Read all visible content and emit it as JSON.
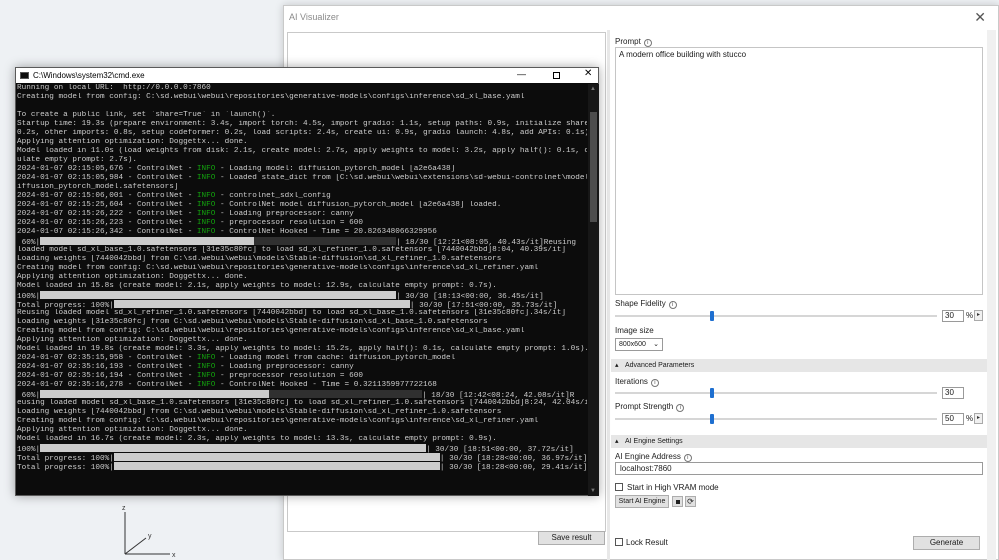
{
  "viz": {
    "title": "AI Visualizer",
    "close": "✕",
    "save_result": "Save result",
    "prompt_label": "Prompt",
    "prompt_text": "A modern office building with stucco",
    "shape_fidelity_label": "Shape Fidelity",
    "shape_fidelity_value": "30",
    "shape_fidelity_level": 0.3,
    "pct": "%",
    "image_size_label": "Image size",
    "image_size_value": "800x600",
    "advanced_header": "Advanced Parameters",
    "iterations_label": "Iterations",
    "iterations_value": "30",
    "iterations_level": 0.3,
    "prompt_strength_label": "Prompt Strength",
    "prompt_strength_value": "50",
    "prompt_strength_level": 0.3,
    "engine_header": "AI Engine Settings",
    "engine_address_label": "AI Engine Address",
    "engine_address_value": "localhost:7860",
    "high_vram_label": "Start in High VRAM mode",
    "start_engine": "Start AI Engine",
    "lock_result": "Lock Result",
    "generate": "Generate",
    "info_glyph": "i",
    "refresh_glyph": "⟳",
    "chevron": "⌄",
    "collapse": "▴",
    "step": "▸"
  },
  "cmd": {
    "title": "C:\\Windows\\system32\\cmd.exe",
    "min": "—",
    "close": "✕",
    "scroll_up": "▲",
    "scroll_down": "▼",
    "lines": [
      {
        "t": "Running on local URL:  http://0.0.0.0:7860"
      },
      {
        "t": "Creating model from config: C:\\sd.webui\\webui\\repositories\\generative-models\\configs\\inference\\sd_xl_base.yaml"
      },
      {
        "t": ""
      },
      {
        "t": "To create a public link, set `share=True` in `launch()`."
      },
      {
        "t": "Startup time: 19.3s (prepare environment: 3.4s, import torch: 4.5s, import gradio: 1.1s, setup paths: 0.9s, initialize shared:"
      },
      {
        "t": "0.2s, other imports: 0.8s, setup codeformer: 0.2s, load scripts: 2.4s, create ui: 0.9s, gradio launch: 4.8s, add APIs: 0.1s)."
      },
      {
        "t": "Applying attention optimization: Doggettx... done."
      },
      {
        "t": "Model loaded in 11.0s (load weights from disk: 2.1s, create model: 2.7s, apply weights to model: 3.2s, apply half(): 0.1s, calc"
      },
      {
        "t": "ulate empty prompt: 2.7s)."
      },
      {
        "a": "2024-01-07 02:15:05,676 - ControlNet - ",
        "g": "INFO",
        "b": " - Loading model: diffusion_pytorch_model [a2e6a438]"
      },
      {
        "a": "2024-01-07 02:15:05,984 - ControlNet - ",
        "g": "INFO",
        "b": " - Loaded state_dict from [C:\\sd.webui\\webui\\extensions\\sd-webui-controlnet\\models\\d"
      },
      {
        "t": "iffusion_pytorch_model.safetensors]"
      },
      {
        "a": "2024-01-07 02:15:06,001 - ControlNet - ",
        "g": "INFO",
        "b": " - controlnet_sdxl_config"
      },
      {
        "a": "2024-01-07 02:15:25,604 - ControlNet - ",
        "g": "INFO",
        "b": " - ControlNet model diffusion_pytorch_model [a2e6a438] loaded."
      },
      {
        "a": "2024-01-07 02:15:26,222 - ControlNet - ",
        "g": "INFO",
        "b": " - Loading preprocessor: canny"
      },
      {
        "a": "2024-01-07 02:15:26,223 - ControlNet - ",
        "g": "INFO",
        "b": " - preprocessor resolution = 600"
      },
      {
        "a": "2024-01-07 02:15:26,342 - ControlNet - ",
        "g": "INFO",
        "b": " - ControlNet Hooked - Time = 20.826348066329956"
      },
      {
        "p": " 60%|",
        "fill": 0.6,
        "w": 356,
        "r": "| 18/30 [12:21<08:05, 40.43s/it]Reusing"
      },
      {
        "t": "loaded model sd_xl_base_1.0.safetensors [31e35c80fc] to load sd_xl_refiner_1.0.safetensors [7440042bbd]8:04, 40.39s/it]"
      },
      {
        "t": "Loading weights [7440042bbd] from C:\\sd.webui\\webui\\models\\Stable-diffusion\\sd_xl_refiner_1.0.safetensors"
      },
      {
        "t": "Creating model from config: C:\\sd.webui\\webui\\repositories\\generative-models\\configs\\inference\\sd_xl_refiner.yaml"
      },
      {
        "t": "Applying attention optimization: Doggettx... done."
      },
      {
        "t": "Model loaded in 15.8s (create model: 2.1s, apply weights to model: 12.9s, calculate empty prompt: 0.7s)."
      },
      {
        "p": "100%|",
        "fill": 1,
        "w": 356,
        "r": "| 30/30 [18:13<00:00, 36.45s/it]"
      },
      {
        "p": "Total progress: 100%|",
        "fill": 1,
        "w": 296,
        "r": "| 30/30 [17:51<00:00, 35.73s/it]"
      },
      {
        "t": "Reusing loaded model sd_xl_refiner_1.0.safetensors [7440042bbd] to load sd_xl_base_1.0.safetensors [31e35c80fc].34s/it]"
      },
      {
        "t": "Loading weights [31e35c80fc] from C:\\sd.webui\\webui\\models\\Stable-diffusion\\sd_xl_base_1.0.safetensors"
      },
      {
        "t": "Creating model from config: C:\\sd.webui\\webui\\repositories\\generative-models\\configs\\inference\\sd_xl_base.yaml"
      },
      {
        "t": "Applying attention optimization: Doggettx... done."
      },
      {
        "t": "Model loaded in 19.8s (create model: 3.3s, apply weights to model: 15.2s, apply half(): 0.1s, calculate empty prompt: 1.0s)."
      },
      {
        "a": "2024-01-07 02:35:15,958 - ControlNet - ",
        "g": "INFO",
        "b": " - Loading model from cache: diffusion_pytorch_model"
      },
      {
        "a": "2024-01-07 02:35:16,193 - ControlNet - ",
        "g": "INFO",
        "b": " - Loading preprocessor: canny"
      },
      {
        "a": "2024-01-07 02:35:16,194 - ControlNet - ",
        "g": "INFO",
        "b": " - preprocessor resolution = 600"
      },
      {
        "a": "2024-01-07 02:35:16,278 - ControlNet - ",
        "g": "INFO",
        "b": " - ControlNet Hooked - Time = 0.3211359977722168"
      },
      {
        "p": " 60%|",
        "fill": 0.6,
        "w": 382,
        "r": "| 18/30 [12:42<08:24, 42.08s/it]R"
      },
      {
        "t": "eusing loaded model sd_xl_base_1.0.safetensors [31e35c80fc] to load sd_xl_refiner_1.0.safetensors [7440042bbd]8:24, 42.04s/it]"
      },
      {
        "t": "Loading weights [7440042bbd] from C:\\sd.webui\\webui\\models\\Stable-diffusion\\sd_xl_refiner_1.0.safetensors"
      },
      {
        "t": "Creating model from config: C:\\sd.webui\\webui\\repositories\\generative-models\\configs\\inference\\sd_xl_refiner.yaml"
      },
      {
        "t": "Applying attention optimization: Doggettx... done."
      },
      {
        "t": "Model loaded in 16.7s (create model: 2.3s, apply weights to model: 13.3s, calculate empty prompt: 0.9s)."
      },
      {
        "p": "100%|",
        "fill": 1,
        "w": 386,
        "r": "| 30/30 [18:51<00:00, 37.72s/it]"
      },
      {
        "p": "Total progress: 100%|",
        "fill": 1,
        "w": 326,
        "r": "| 30/30 [18:28<00:00, 36.97s/it]"
      },
      {
        "p": "Total progress: 100%|",
        "fill": 1,
        "w": 326,
        "r": "| 30/30 [18:28<00:00, 29.41s/it]"
      }
    ]
  },
  "desktop": {
    "axis_z": "z",
    "axis_y": "y",
    "axis_x": "x"
  }
}
